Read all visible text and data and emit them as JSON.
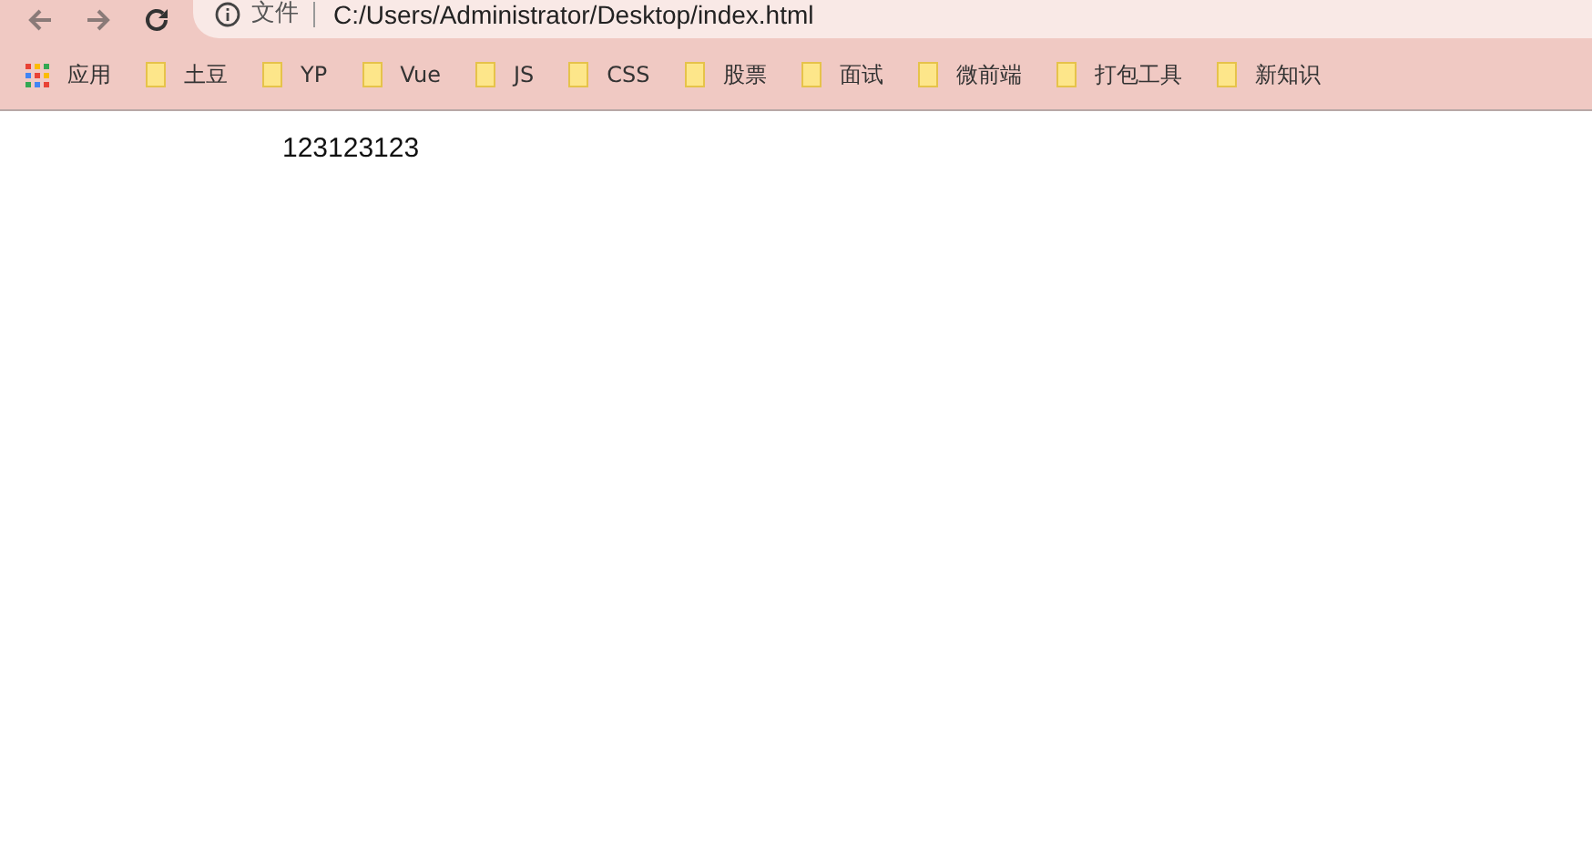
{
  "address_bar": {
    "security_label": "文件",
    "url": "C:/Users/Administrator/Desktop/index.html"
  },
  "bookmarks": [
    {
      "kind": "apps",
      "label": "应用"
    },
    {
      "kind": "folder",
      "label": "土豆"
    },
    {
      "kind": "folder",
      "label": "YP"
    },
    {
      "kind": "folder",
      "label": "Vue"
    },
    {
      "kind": "folder",
      "label": "JS"
    },
    {
      "kind": "folder",
      "label": "CSS"
    },
    {
      "kind": "folder",
      "label": "股票"
    },
    {
      "kind": "folder",
      "label": "面试"
    },
    {
      "kind": "folder",
      "label": "微前端"
    },
    {
      "kind": "folder",
      "label": "打包工具"
    },
    {
      "kind": "folder",
      "label": "新知识"
    }
  ],
  "page": {
    "text": "123123123"
  }
}
